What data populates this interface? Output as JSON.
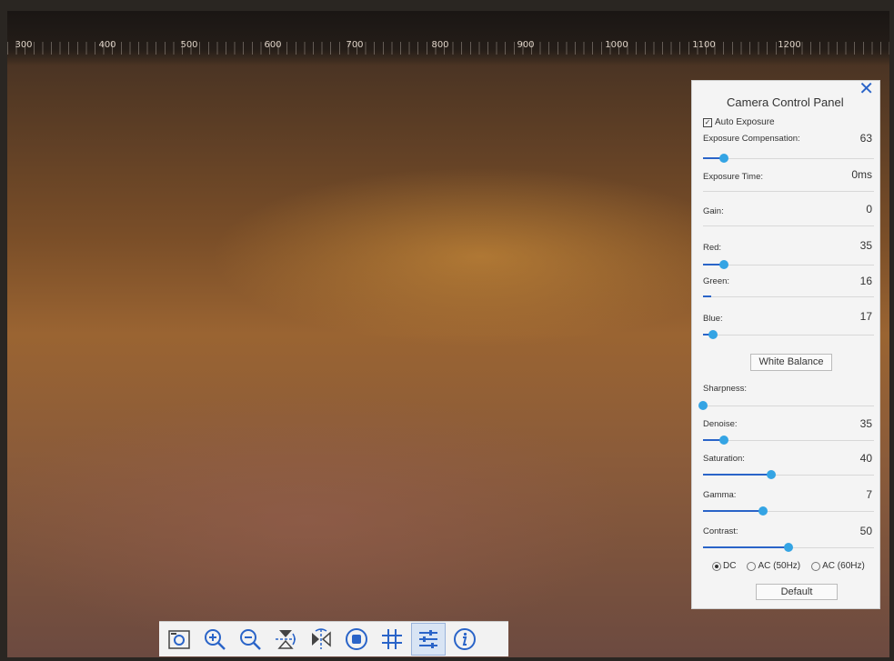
{
  "ruler": {
    "labels": [
      "300",
      "400",
      "500",
      "600",
      "700",
      "800",
      "900",
      "1000",
      "1100",
      "1200"
    ]
  },
  "panel": {
    "title": "Camera Control Panel",
    "close_icon": "close-icon",
    "auto_exposure": {
      "label": "Auto Exposure",
      "checked": true
    },
    "exposure_compensation": {
      "label": "Exposure Compensation:",
      "value": "63"
    },
    "exposure_time": {
      "label": "Exposure Time:",
      "value": "0ms"
    },
    "gain": {
      "label": "Gain:",
      "value": "0"
    },
    "red": {
      "label": "Red:",
      "value": "35"
    },
    "green": {
      "label": "Green:",
      "value": "16"
    },
    "blue": {
      "label": "Blue:",
      "value": "17"
    },
    "white_balance_button": "White Balance",
    "sharpness": {
      "label": "Sharpness:",
      "value": ""
    },
    "denoise": {
      "label": "Denoise:",
      "value": "35"
    },
    "saturation": {
      "label": "Saturation:",
      "value": "40"
    },
    "gamma": {
      "label": "Gamma:",
      "value": "7"
    },
    "contrast": {
      "label": "Contrast:",
      "value": "50"
    },
    "power_freq": {
      "dc": "DC",
      "ac50": "AC (50Hz)",
      "ac60": "AC (60Hz)",
      "selected": "DC"
    },
    "default_button": "Default"
  },
  "slider_levels": {
    "exposure_compensation": 0.12,
    "exposure_time": 0.0,
    "gain": 0.0,
    "red": 0.12,
    "green": 0.05,
    "blue": 0.06,
    "sharpness": 0.0,
    "denoise": 0.12,
    "saturation": 0.4,
    "gamma": 0.35,
    "contrast": 0.5
  },
  "toolbar": {
    "icons": [
      "capture-icon",
      "zoom-in-icon",
      "zoom-out-icon",
      "flip-vertical-icon",
      "flip-horizontal-icon",
      "stop-icon",
      "grid-icon",
      "settings-sliders-icon",
      "info-icon"
    ],
    "active": "settings-sliders-icon",
    "accent": "#2a64c8"
  }
}
